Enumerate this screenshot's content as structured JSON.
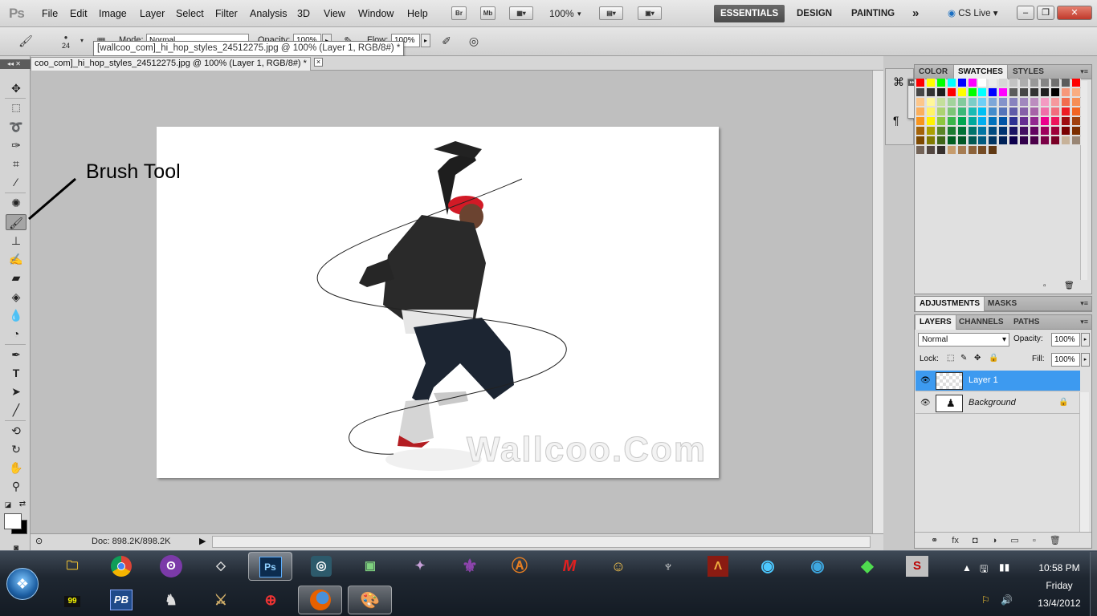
{
  "app": {
    "logo": "Ps"
  },
  "menu": [
    "File",
    "Edit",
    "Image",
    "Layer",
    "Select",
    "Filter",
    "Analysis",
    "3D",
    "View",
    "Window",
    "Help"
  ],
  "menubar_extras": {
    "bridge": "Br",
    "minibridge": "Mb",
    "zoom": "100%"
  },
  "workspaces": {
    "essentials": "ESSENTIALS",
    "design": "DESIGN",
    "painting": "PAINTING",
    "more": "»",
    "cslive": "CS Live"
  },
  "options_bar": {
    "brush_size": "24",
    "mode_label": "Mode:",
    "mode_value": "Normal",
    "opacity_label": "Opacity:",
    "opacity_value": "100%",
    "flow_label": "Flow:",
    "flow_value": "100%"
  },
  "tooltip": "[wallcoo_com]_hi_hop_styles_24512275.jpg @ 100% (Layer 1, RGB/8#) *",
  "document": {
    "tab_title": "coo_com]_hi_hop_styles_24512275.jpg @ 100% (Layer 1, RGB/8#) *",
    "tab_close": "×",
    "watermark": "Wallcoo.Com",
    "doc_info": "Doc: 898.2K/898.2K"
  },
  "annotation": {
    "label": "Brush Tool"
  },
  "swatches_panel": {
    "tabs": [
      "COLOR",
      "SWATCHES",
      "STYLES"
    ],
    "active_tab": "SWATCHES"
  },
  "adjustments_panel": {
    "tabs": [
      "ADJUSTMENTS",
      "MASKS"
    ]
  },
  "layers_panel": {
    "tabs": [
      "LAYERS",
      "CHANNELS",
      "PATHS"
    ],
    "blend_mode": "Normal",
    "opacity_label": "Opacity:",
    "opacity_value": "100%",
    "lock_label": "Lock:",
    "fill_label": "Fill:",
    "fill_value": "100%",
    "layers": [
      {
        "name": "Layer 1",
        "selected": true
      },
      {
        "name": "Background",
        "selected": false,
        "locked": true
      }
    ]
  },
  "taskbar": {
    "time": "10:58 PM",
    "day": "Friday",
    "date": "13/4/2012",
    "apps_row1": [
      "explorer-folder",
      "chrome",
      "bittorrent",
      "unity",
      "photoshop",
      "3dsmax",
      "desktop-monitor",
      "saints-row",
      "saints-fleur",
      "anarchy",
      "mafia",
      "fallout-vault-boy",
      "skyrim",
      "age-of-empires",
      "sims-globe",
      "sims-globe-2",
      "sims-3",
      "syndicate"
    ],
    "apps_row2": [
      "counter-99",
      "pb",
      "counter-strike",
      "mount-blade",
      "crossfire",
      "firefox",
      "paint"
    ],
    "ps_label": "Ps",
    "pb_label": "PB",
    "num_label": "99",
    "mafia_label": "M"
  },
  "colors": {
    "accent_selected_layer": "#3d9af0",
    "essentials_bg": "#555555"
  }
}
